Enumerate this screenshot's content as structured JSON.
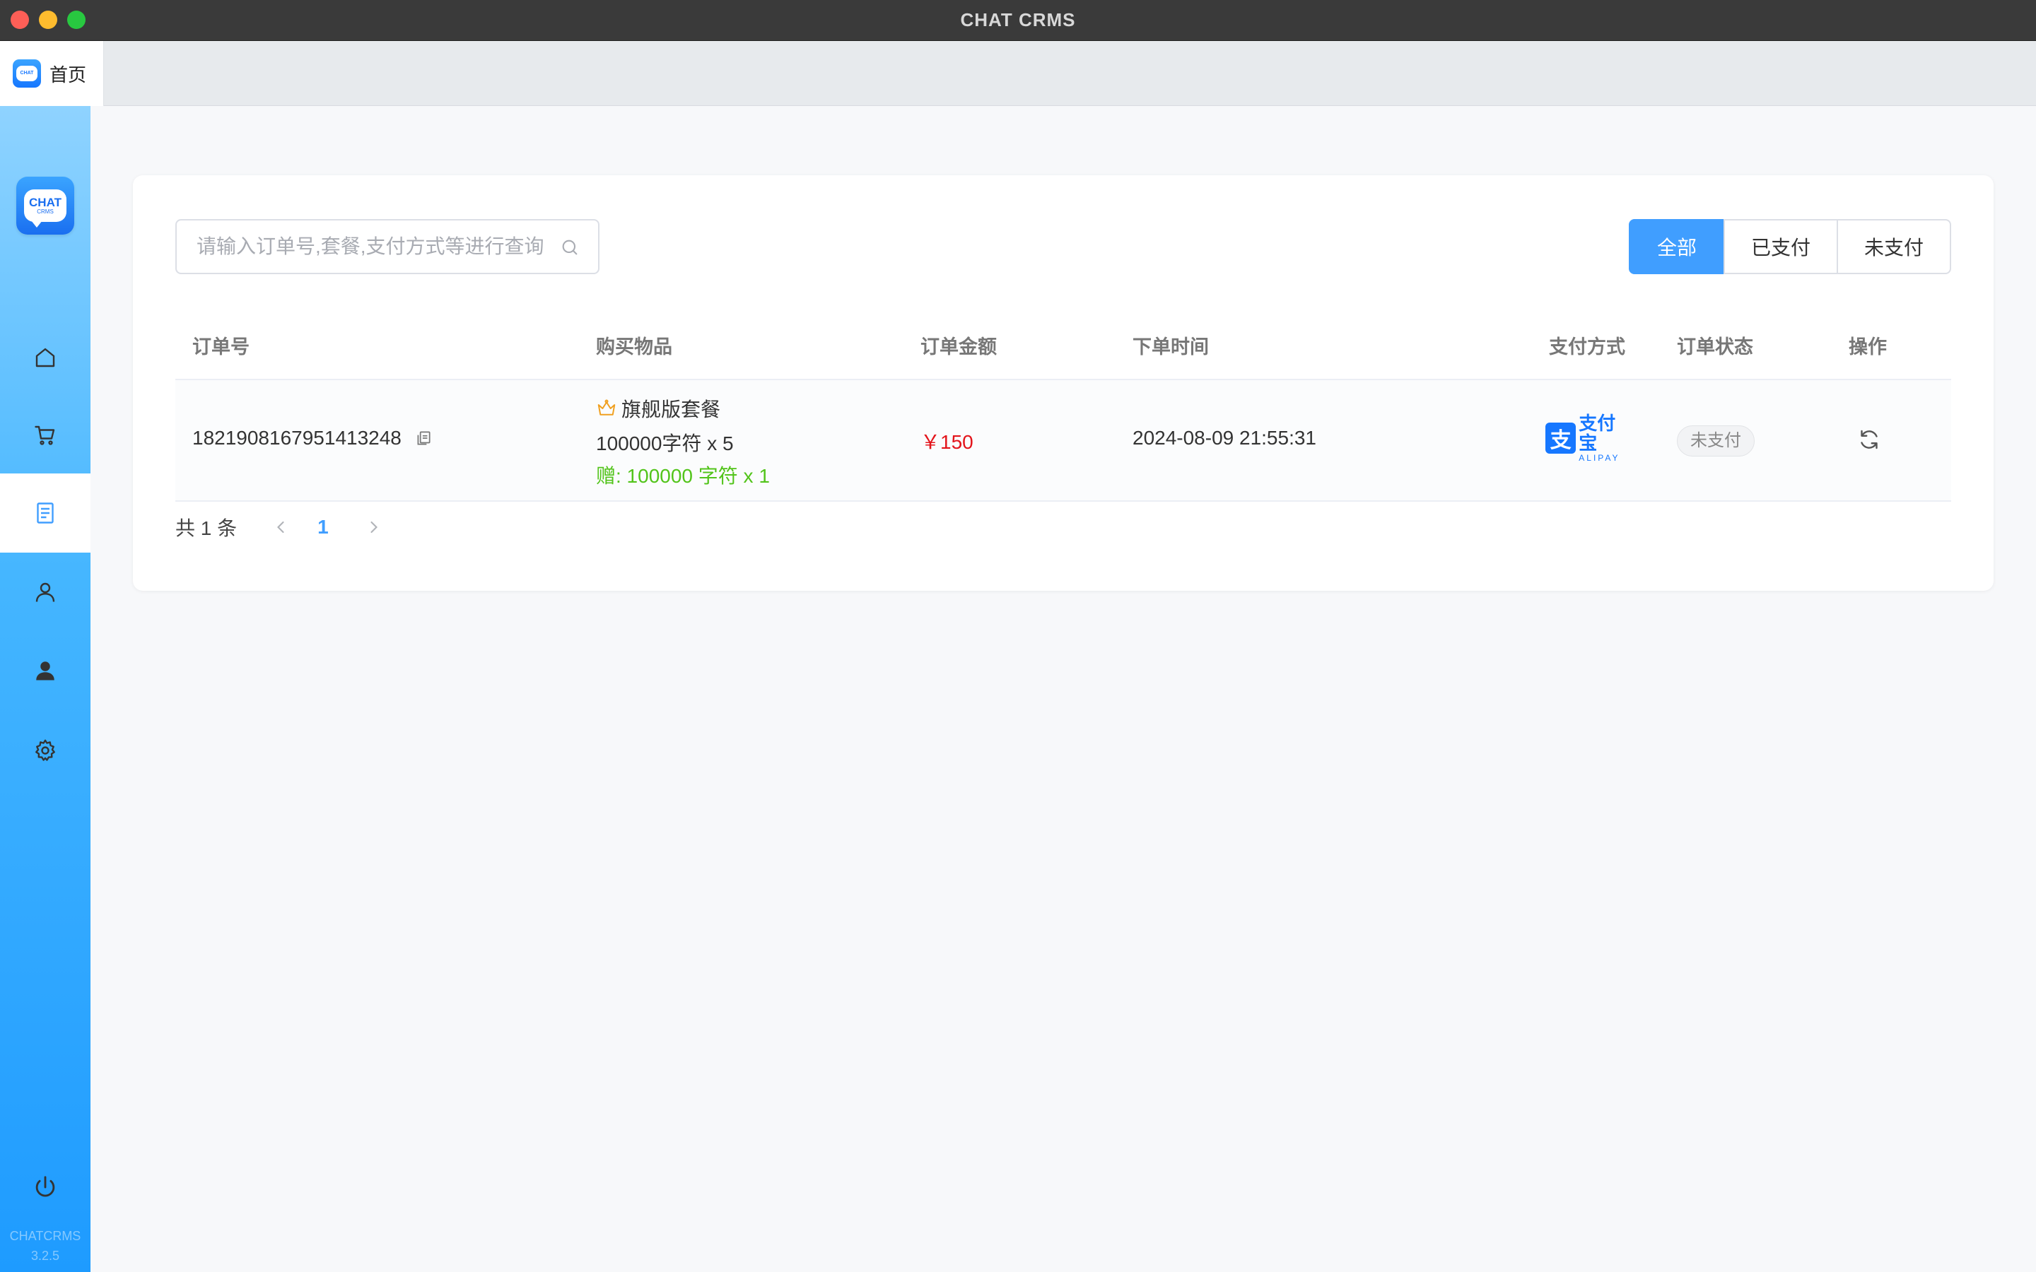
{
  "window": {
    "title": "CHAT CRMS"
  },
  "tabs": [
    {
      "label": "首页",
      "logo_text": "CHAT"
    }
  ],
  "sidebar": {
    "logo_line1": "CHAT",
    "logo_line2": "CRMS",
    "items": [
      {
        "icon": "home-icon"
      },
      {
        "icon": "cart-icon"
      },
      {
        "icon": "document-icon",
        "active": true
      },
      {
        "icon": "user-outline-icon"
      },
      {
        "icon": "user-filled-icon"
      },
      {
        "icon": "gear-icon"
      }
    ],
    "power_icon": "power-icon",
    "version_name": "CHATCRMS",
    "version_number": "3.2.5"
  },
  "search": {
    "placeholder": "请输入订单号,套餐,支付方式等进行查询",
    "value": ""
  },
  "filters": [
    {
      "label": "全部",
      "active": true
    },
    {
      "label": "已支付",
      "active": false
    },
    {
      "label": "未支付",
      "active": false
    }
  ],
  "table": {
    "headers": [
      "订单号",
      "购买物品",
      "订单金额",
      "下单时间",
      "支付方式",
      "订单状态",
      "操作"
    ],
    "rows": [
      {
        "order_no": "1821908167951413248",
        "item_name": "旗舰版套餐",
        "item_detail": "100000字符 x 5",
        "item_bonus": "赠: 100000 字符 x 1",
        "amount": "￥150",
        "time": "2024-08-09 21:55:31",
        "payment_icon_char": "支",
        "payment_cn": "支付宝",
        "payment_en": "ALIPAY",
        "status": "未支付"
      }
    ]
  },
  "pagination": {
    "total": "共 1 条",
    "current_page": "1"
  },
  "colors": {
    "accent": "#409eff",
    "amount": "#e3141b",
    "bonus": "#52c41a",
    "alipay": "#1677ff"
  }
}
